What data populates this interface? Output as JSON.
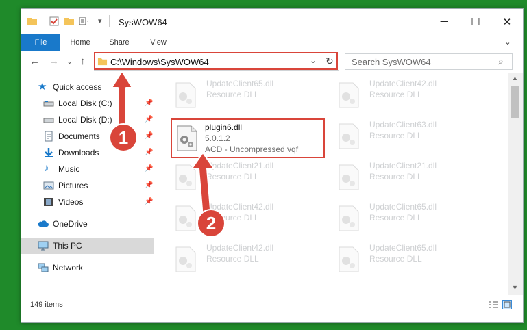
{
  "window": {
    "title": "SysWOW64",
    "minimize": "─",
    "maximize": "☐",
    "close": "✕"
  },
  "ribbon": {
    "tabs": [
      "File",
      "Home",
      "Share",
      "View"
    ],
    "expand": "⌄"
  },
  "nav": {
    "back": "←",
    "forward": "→",
    "recent": "⌄",
    "up": "↑",
    "address": "C:\\Windows\\SysWOW64",
    "address_dropdown": "⌄",
    "refresh": "↻",
    "search_placeholder": "Search SysWOW64",
    "search_icon": "⌕"
  },
  "sidebar": {
    "items": [
      {
        "label": "Quick access",
        "icon": "star-icon",
        "pinned": false
      },
      {
        "label": "Local Disk (C:)",
        "icon": "drive-icon",
        "pinned": true
      },
      {
        "label": "Local Disk (D:)",
        "icon": "drive-icon",
        "pinned": true
      },
      {
        "label": "Documents",
        "icon": "documents-icon",
        "pinned": true
      },
      {
        "label": "Downloads",
        "icon": "downloads-icon",
        "pinned": true
      },
      {
        "label": "Music",
        "icon": "music-icon",
        "pinned": true
      },
      {
        "label": "Pictures",
        "icon": "pictures-icon",
        "pinned": true
      },
      {
        "label": "Videos",
        "icon": "videos-icon",
        "pinned": true
      },
      {
        "label": "OneDrive",
        "icon": "onedrive-icon",
        "pinned": false
      },
      {
        "label": "This PC",
        "icon": "computer-icon",
        "pinned": false
      },
      {
        "label": "Network",
        "icon": "network-icon",
        "pinned": false
      }
    ]
  },
  "files": {
    "left": [
      {
        "name": "UpdateClient65.dll",
        "desc": "Resource DLL"
      },
      {
        "name": "UpdateClient21.dll",
        "desc": "Resource DLL"
      },
      {
        "name": "UpdateClient42.dll",
        "desc": "Resource DLL"
      }
    ],
    "highlighted": {
      "name": "plugin6.dll",
      "version": "5.0.1.2",
      "desc": "ACD - Uncompressed vqf"
    },
    "right": [
      {
        "name": "UpdateClient42.dll",
        "desc": "Resource DLL"
      },
      {
        "name": "UpdateClient63.dll",
        "desc": "Resource DLL"
      },
      {
        "name": "UpdateClient21.dll",
        "desc": "Resource DLL"
      },
      {
        "name": "UpdateClient65.dll",
        "desc": "Resource DLL"
      },
      {
        "name": "UpdateClient65.dll",
        "desc": "Resource DLL"
      }
    ]
  },
  "status": {
    "item_count": "149 items"
  },
  "annotations": {
    "step1": "1",
    "step2": "2"
  },
  "colors": {
    "accent": "#1979ca",
    "annotation": "#d9453a",
    "selected": "#cce8ff"
  }
}
